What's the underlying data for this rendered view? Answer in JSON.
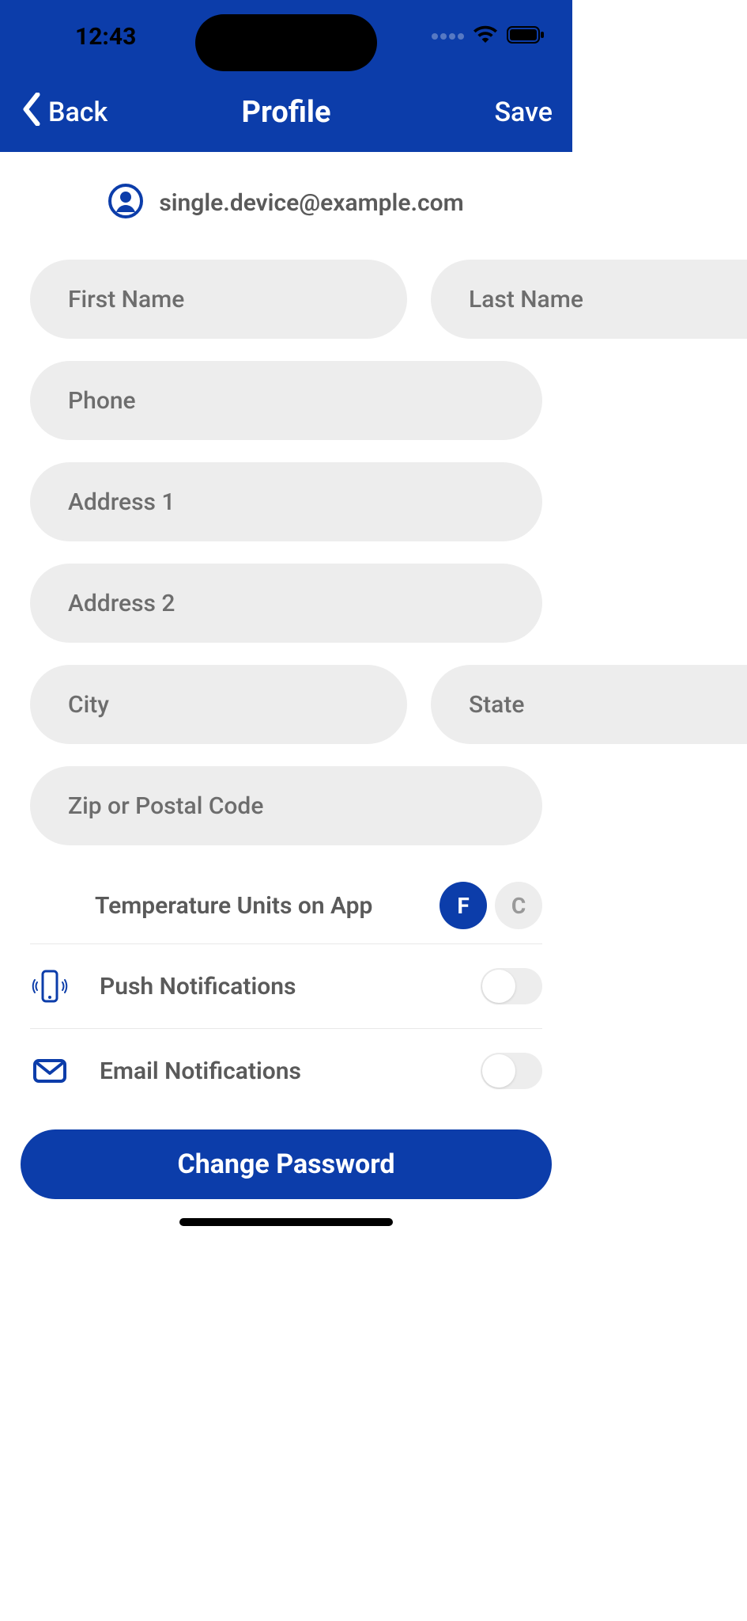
{
  "statusBar": {
    "time": "12:43"
  },
  "nav": {
    "back": "Back",
    "title": "Profile",
    "save": "Save"
  },
  "user": {
    "email": "single.device@example.com"
  },
  "form": {
    "firstNamePlaceholder": "First Name",
    "lastNamePlaceholder": "Last Name",
    "phonePlaceholder": "Phone",
    "address1Placeholder": "Address 1",
    "address2Placeholder": "Address 2",
    "cityPlaceholder": "City",
    "statePlaceholder": "State",
    "zipPlaceholder": "Zip or Postal Code"
  },
  "settings": {
    "tempUnitsLabel": "Temperature Units on App",
    "tempF": "F",
    "tempC": "C",
    "pushLabel": "Push Notifications",
    "emailLabel": "Email Notifications"
  },
  "footer": {
    "changePassword": "Change Password"
  }
}
